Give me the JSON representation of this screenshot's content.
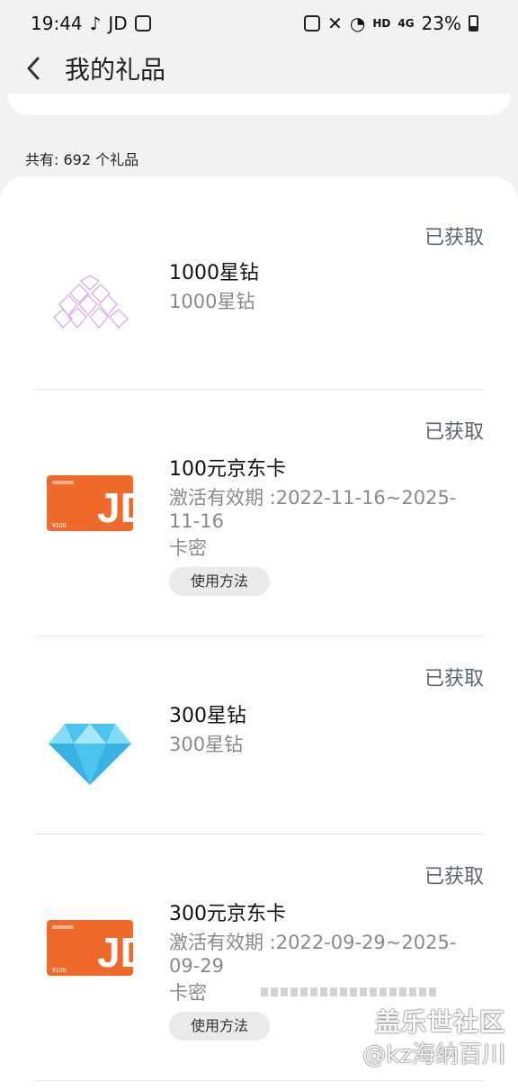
{
  "status_bar": {
    "time": "19:44",
    "app_text": "JD",
    "right_text": "23%",
    "hd_text": "HD",
    "net_text": "4G"
  },
  "header": {
    "title": "我的礼品",
    "back_icon": "back-icon"
  },
  "summary": {
    "count_text": "共有: 692 个礼品"
  },
  "items": [
    {
      "status": "已获取",
      "title": "1000星钻",
      "subtitle": "1000星钻",
      "icon": "diamond-cluster-icon"
    },
    {
      "status": "已获取",
      "title": "100元京东卡",
      "subtitle": "激活有效期 :2022-11-16~2025-\n11-16",
      "card_label": "卡密",
      "button": "使用方法",
      "icon": "jd-card-icon"
    },
    {
      "status": "已获取",
      "title": "300星钻",
      "subtitle": "300星钻",
      "icon": "diamond-icon"
    },
    {
      "status": "已获取",
      "title": "300元京东卡",
      "subtitle": "激活有效期 :2022-09-29~2025-\n09-29",
      "card_label": "卡密",
      "button": "使用方法",
      "icon": "jd-card-icon"
    }
  ],
  "watermark": {
    "line1": "盖乐世社区",
    "line2": "@kz海纳百川"
  },
  "colors": {
    "background": "#f2f2f2",
    "card": "#ffffff",
    "jd_orange": "#ef6a2a",
    "diamond_blue": "#4cc4ee"
  }
}
